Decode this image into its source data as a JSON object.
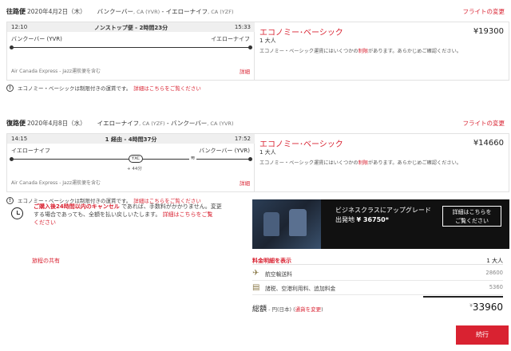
{
  "outbound": {
    "label": "往路便",
    "date": "2020年4月2日（木）",
    "origin": "バンクーバー",
    "origin_code": ", CA (YVR)",
    "sep": " - ",
    "dest": "イエローナイフ",
    "dest_code": ", CA (YZF)",
    "change_link": "フライトの変更",
    "depart_time": "12:10",
    "stops_duration": "ノンストップ便 - 2時間23分",
    "arrive_time": "15:33",
    "from_city": "バンクーバー (YVR)",
    "to_city": "イエローナイフ",
    "carrier": "Air Canada Express - Jazz運航便を含む",
    "detail_link": "詳細",
    "fare_name": "エコノミー･ベーシック",
    "pax": "1 大人",
    "note_prefix": "エコノミー・ベーシック運賃にはいくつかの",
    "note_link": "制限",
    "note_suffix": "があります。あらかじめご確認ください。",
    "price": "¥19300"
  },
  "outbound_warning": {
    "icon": "!",
    "text": "エコノミー・ベーシックは制限付きの運賃です。",
    "link": "詳細はこちらをご覧ください"
  },
  "return": {
    "label": "復路便",
    "date": "2020年4月8日（水）",
    "origin": "イエローナイフ",
    "origin_code": ", CA (YZF)",
    "sep": " - ",
    "dest": "バンクーバー",
    "dest_code": ", CA (YVR)",
    "change_link": "フライトの変更",
    "depart_time": "14:15",
    "stops_duration": "1 経由 - 4時間37分",
    "arrive_time": "17:52",
    "from_city": "イエローナイフ",
    "to_city": "バンクーバー (YVR)",
    "stop_code": "YXC",
    "layover": "+ 44分",
    "wifi_icon": "≋",
    "carrier": "Air Canada Express - Jazz運航便を含む",
    "detail_link": "詳細",
    "fare_name": "エコノミー･ベーシック",
    "pax": "1 大人",
    "note_prefix": "エコノミー・ベーシック運賃にはいくつかの",
    "note_link": "制限",
    "note_suffix": "があります。あらかじめご確認ください。",
    "price": "¥14660"
  },
  "return_warning": {
    "icon": "!",
    "text": "エコノミー・ベーシックは制限付きの運賃です。",
    "link": "詳細はこちらをご覧ください"
  },
  "cancel": {
    "bold": "ご購入後24時間以内のキャンセル",
    "text1": "であれば、手数料がかかりません。変更",
    "text2": "する場合であっても、全額を払い戻しいたします。",
    "link1": "詳細はこちらをご覧",
    "link2": "ください"
  },
  "share_link": "旅程の共有",
  "promo": {
    "line1": "ビジネスクラスにアップグレード",
    "line2_prefix": "出発地 ",
    "line2_price": "¥ 36750*",
    "button_line1": "詳細はこちらを",
    "button_line2": "ご覧ください"
  },
  "breakdown": {
    "header": "料金明細を表示",
    "pax": "1 大人",
    "rows": [
      {
        "icon": "✈",
        "label": "航空輸送料",
        "value": "28600"
      },
      {
        "icon": "▤",
        "label": "諸税、空港利用料、追加料金",
        "value": "5360"
      }
    ]
  },
  "total": {
    "label": "総額",
    "sub_prefix": " - 円(日本) (",
    "sub_link": "通貨を変更",
    "sub_suffix": ")",
    "currency": "¥",
    "amount": "33960"
  },
  "cta_label": "続行",
  "colors": {
    "accent": "#d92231",
    "header_bg": "#efefef",
    "promo_bg": "#111111"
  }
}
